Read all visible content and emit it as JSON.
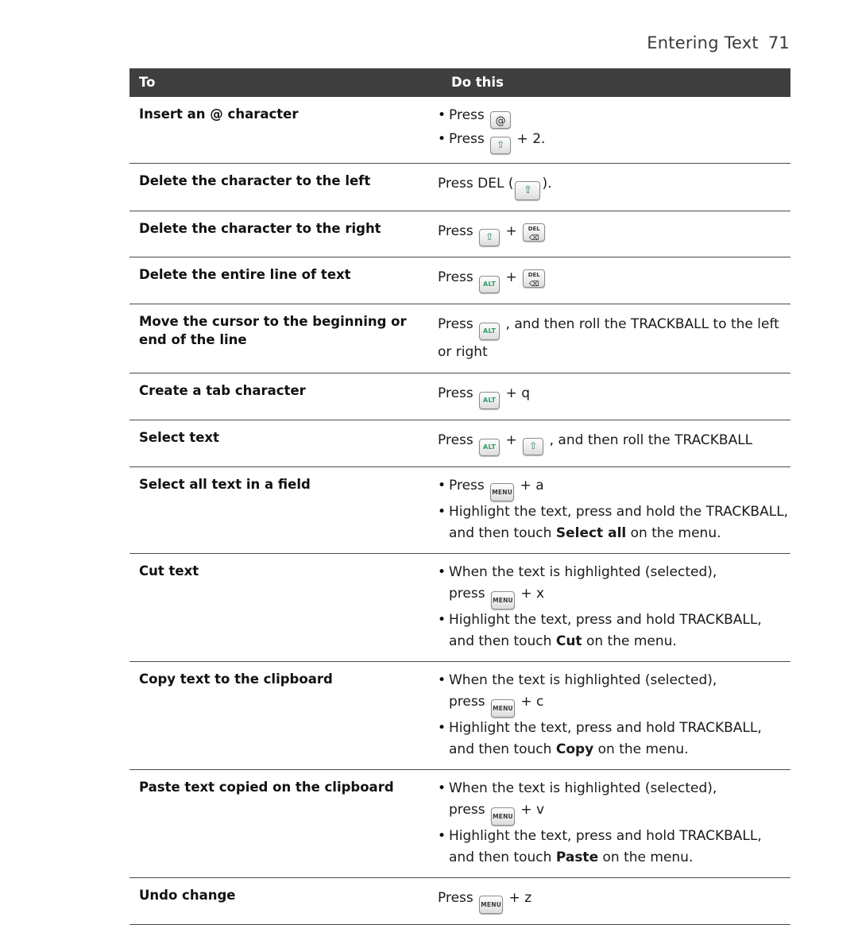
{
  "header": {
    "title": "Entering Text",
    "page_number": "71"
  },
  "table": {
    "columns": [
      "To",
      "Do this"
    ],
    "rows": [
      {
        "to": "Insert an @ character",
        "lines": [
          {
            "style": "bullet",
            "parts": [
              {
                "t": "text",
                "v": "Press "
              },
              {
                "t": "key",
                "k": "at"
              }
            ]
          },
          {
            "style": "bullet",
            "parts": [
              {
                "t": "text",
                "v": "Press "
              },
              {
                "t": "key",
                "k": "shift"
              },
              {
                "t": "text",
                "v": " + 2."
              }
            ]
          }
        ]
      },
      {
        "to": "Delete the character to the left",
        "lines": [
          {
            "style": "plain",
            "parts": [
              {
                "t": "text",
                "v": "Press DEL ("
              },
              {
                "t": "key",
                "k": "shift-lg"
              },
              {
                "t": "text",
                "v": ")."
              }
            ]
          }
        ]
      },
      {
        "to": "Delete the character to the right",
        "lines": [
          {
            "style": "plain",
            "parts": [
              {
                "t": "text",
                "v": "Press "
              },
              {
                "t": "key",
                "k": "shift"
              },
              {
                "t": "text",
                "v": " + "
              },
              {
                "t": "key",
                "k": "del"
              }
            ]
          }
        ]
      },
      {
        "to": "Delete the entire line of text",
        "lines": [
          {
            "style": "plain",
            "parts": [
              {
                "t": "text",
                "v": "Press "
              },
              {
                "t": "key",
                "k": "alt"
              },
              {
                "t": "text",
                "v": " + "
              },
              {
                "t": "key",
                "k": "del"
              }
            ]
          }
        ]
      },
      {
        "to": "Move the cursor to the beginning or end of the line",
        "lines": [
          {
            "style": "plain",
            "parts": [
              {
                "t": "text",
                "v": "Press "
              },
              {
                "t": "key",
                "k": "alt"
              },
              {
                "t": "text",
                "v": " , and then roll the TRACKBALL to the left"
              }
            ]
          },
          {
            "style": "plain",
            "parts": [
              {
                "t": "text",
                "v": "or right"
              }
            ]
          }
        ]
      },
      {
        "to": "Create a tab character",
        "lines": [
          {
            "style": "plain",
            "parts": [
              {
                "t": "text",
                "v": "Press "
              },
              {
                "t": "key",
                "k": "alt"
              },
              {
                "t": "text",
                "v": " + q"
              }
            ]
          }
        ]
      },
      {
        "to": "Select text",
        "lines": [
          {
            "style": "plain",
            "parts": [
              {
                "t": "text",
                "v": "Press "
              },
              {
                "t": "key",
                "k": "alt"
              },
              {
                "t": "text",
                "v": " + "
              },
              {
                "t": "key",
                "k": "shift"
              },
              {
                "t": "text",
                "v": " , and then roll the TRACKBALL"
              }
            ]
          }
        ]
      },
      {
        "to": "Select all text in a field",
        "lines": [
          {
            "style": "bullet",
            "parts": [
              {
                "t": "text",
                "v": "Press "
              },
              {
                "t": "key",
                "k": "menu"
              },
              {
                "t": "text",
                "v": " + a"
              }
            ]
          },
          {
            "style": "bullet",
            "parts": [
              {
                "t": "text",
                "v": "Highlight the text, press and hold the TRACKBALL,"
              }
            ]
          },
          {
            "style": "cont",
            "parts": [
              {
                "t": "text",
                "v": "and then touch "
              },
              {
                "t": "bold",
                "v": "Select all"
              },
              {
                "t": "text",
                "v": " on the menu."
              }
            ]
          }
        ]
      },
      {
        "to": "Cut text",
        "lines": [
          {
            "style": "bullet",
            "parts": [
              {
                "t": "text",
                "v": "When the text is highlighted (selected),"
              }
            ]
          },
          {
            "style": "cont",
            "parts": [
              {
                "t": "text",
                "v": "press "
              },
              {
                "t": "key",
                "k": "menu"
              },
              {
                "t": "text",
                "v": " + x"
              }
            ]
          },
          {
            "style": "bullet",
            "parts": [
              {
                "t": "text",
                "v": "Highlight the text, press and hold TRACKBALL,"
              }
            ]
          },
          {
            "style": "cont",
            "parts": [
              {
                "t": "text",
                "v": "and then touch "
              },
              {
                "t": "bold",
                "v": "Cut"
              },
              {
                "t": "text",
                "v": " on the menu."
              }
            ]
          }
        ]
      },
      {
        "to": "Copy text to the clipboard",
        "lines": [
          {
            "style": "bullet",
            "parts": [
              {
                "t": "text",
                "v": "When the text is highlighted (selected),"
              }
            ]
          },
          {
            "style": "cont",
            "parts": [
              {
                "t": "text",
                "v": "press "
              },
              {
                "t": "key",
                "k": "menu"
              },
              {
                "t": "text",
                "v": " + c"
              }
            ]
          },
          {
            "style": "bullet",
            "parts": [
              {
                "t": "text",
                "v": "Highlight the text, press and hold TRACKBALL,"
              }
            ]
          },
          {
            "style": "cont",
            "parts": [
              {
                "t": "text",
                "v": "and then touch "
              },
              {
                "t": "bold",
                "v": "Copy"
              },
              {
                "t": "text",
                "v": " on the menu."
              }
            ]
          }
        ]
      },
      {
        "to": "Paste text copied on the clipboard",
        "lines": [
          {
            "style": "bullet",
            "parts": [
              {
                "t": "text",
                "v": "When the text is highlighted (selected),"
              }
            ]
          },
          {
            "style": "cont",
            "parts": [
              {
                "t": "text",
                "v": "press "
              },
              {
                "t": "key",
                "k": "menu"
              },
              {
                "t": "text",
                "v": " + v"
              }
            ]
          },
          {
            "style": "bullet",
            "parts": [
              {
                "t": "text",
                "v": "Highlight the text, press and hold TRACKBALL,"
              }
            ]
          },
          {
            "style": "cont",
            "parts": [
              {
                "t": "text",
                "v": "and then touch "
              },
              {
                "t": "bold",
                "v": "Paste"
              },
              {
                "t": "text",
                "v": " on the menu."
              }
            ]
          }
        ]
      },
      {
        "to": "Undo change",
        "lines": [
          {
            "style": "plain",
            "parts": [
              {
                "t": "text",
                "v": "Press "
              },
              {
                "t": "key",
                "k": "menu"
              },
              {
                "t": "text",
                "v": " + z"
              }
            ]
          }
        ]
      }
    ]
  },
  "keys": {
    "at": {
      "label": "@",
      "name": "at-key-icon"
    },
    "shift": {
      "label": "⇧",
      "name": "shift-key-icon"
    },
    "shift-lg": {
      "label": "⇧",
      "name": "shift-key-icon"
    },
    "alt": {
      "label": "ALT",
      "name": "alt-key-icon"
    },
    "menu": {
      "label": "MENU",
      "name": "menu-key-icon"
    },
    "del": {
      "label": "DEL",
      "label2": "⌫",
      "name": "delete-key-icon"
    }
  },
  "colors": {
    "header_bar": "#3f3f3f",
    "rule": "#4a4a4a",
    "alt_green": "#2f9e68",
    "shift_green": "#2f7f4f"
  }
}
